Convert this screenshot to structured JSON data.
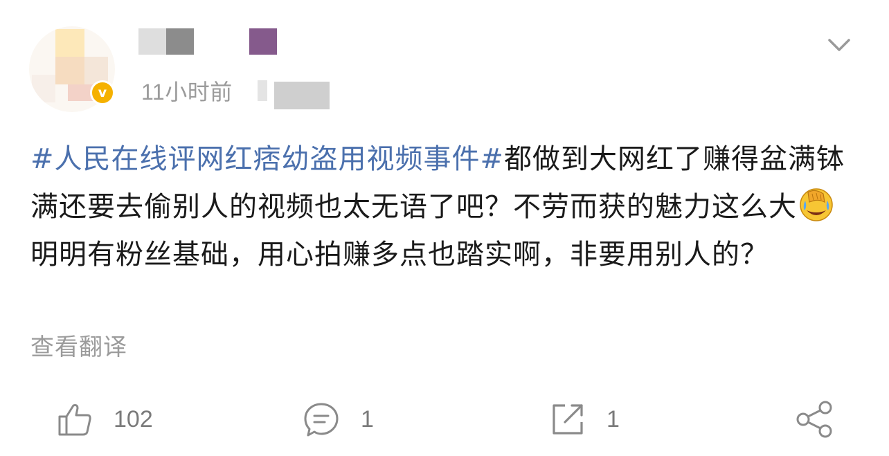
{
  "post": {
    "author": {
      "avatar_icon": "avatar-image",
      "verified_badge": "v",
      "verified_color": "#f5b100"
    },
    "time": "11小时前",
    "text": {
      "hashtag": "#人民在线评网红痞幼盗用视频事件#",
      "part1": "都做到大网红了赚得盆满钵满还要去偷别人的视频也太无语了吧？不劳而获的魅力这么大",
      "emoji": "facepalm-laughing-emoji",
      "part2": "明明有粉丝基础，用心拍赚多点也踏实啊，非要用别人的？"
    },
    "translate_label": "查看翻译",
    "hashtag_color": "#4b70ad"
  },
  "actions": {
    "like": {
      "icon": "thumbs-up-icon",
      "count": "102"
    },
    "comment": {
      "icon": "comment-icon",
      "count": "1"
    },
    "repost": {
      "icon": "repost-icon",
      "count": "1"
    },
    "share": {
      "icon": "share-icon"
    }
  },
  "menu": {
    "icon": "chevron-down-icon"
  }
}
